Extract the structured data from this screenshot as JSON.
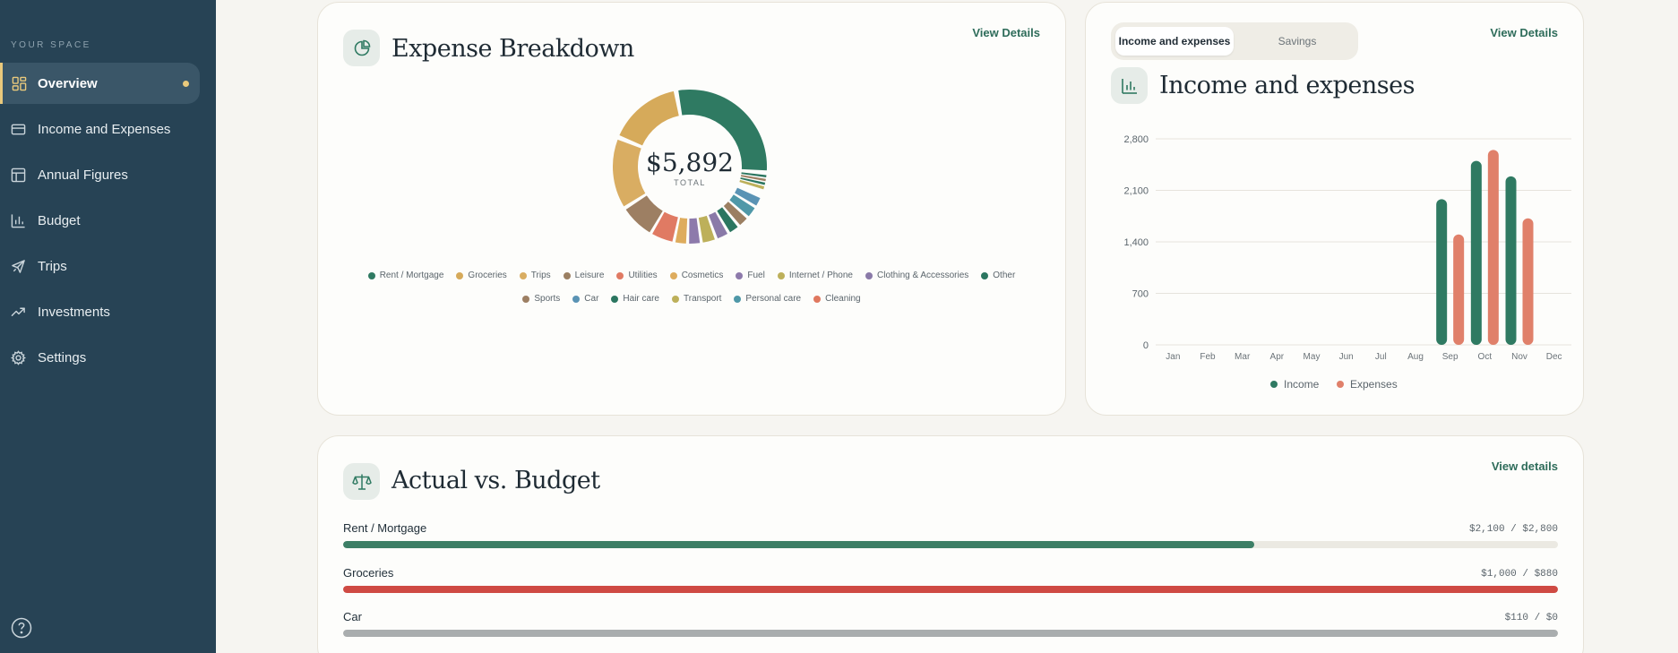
{
  "sidebar": {
    "section_label": "YOUR SPACE",
    "items": [
      {
        "label": "Overview",
        "icon": "dashboard-icon",
        "active": true
      },
      {
        "label": "Income and Expenses",
        "icon": "card-icon"
      },
      {
        "label": "Annual Figures",
        "icon": "table-icon"
      },
      {
        "label": "Budget",
        "icon": "bar-chart-icon"
      },
      {
        "label": "Trips",
        "icon": "plane-icon"
      },
      {
        "label": "Investments",
        "icon": "trending-up-icon"
      },
      {
        "label": "Settings",
        "icon": "gear-icon"
      }
    ],
    "help_icon": "help-circle-icon"
  },
  "expense_breakdown": {
    "title": "Expense Breakdown",
    "view_link": "View Details",
    "total_value": "$5,892",
    "total_label": "TOTAL",
    "categories": [
      {
        "name": "Rent / Mortgage",
        "color": "#2f7a62"
      },
      {
        "name": "Groceries",
        "color": "#d6aa5a"
      },
      {
        "name": "Trips",
        "color": "#d9ad62"
      },
      {
        "name": "Leisure",
        "color": "#9b7f62"
      },
      {
        "name": "Utilities",
        "color": "#e07a63"
      },
      {
        "name": "Cosmetics",
        "color": "#deac5d"
      },
      {
        "name": "Fuel",
        "color": "#8d7aab"
      },
      {
        "name": "Internet / Phone",
        "color": "#bdb05a"
      },
      {
        "name": "Clothing & Accessories",
        "color": "#8a7aa8"
      },
      {
        "name": "Other",
        "color": "#2b7660"
      },
      {
        "name": "Sports",
        "color": "#9d7f63"
      },
      {
        "name": "Car",
        "color": "#5a93b4"
      },
      {
        "name": "Hair care",
        "color": "#2b7660"
      },
      {
        "name": "Transport",
        "color": "#bdb05a"
      },
      {
        "name": "Personal care",
        "color": "#4f98a8"
      },
      {
        "name": "Cleaning",
        "color": "#e0785f"
      }
    ]
  },
  "income_expenses": {
    "tabs": [
      "Income and expenses",
      "Savings"
    ],
    "active_tab": 0,
    "title": "Income and expenses",
    "view_link": "View Details",
    "legend": [
      {
        "name": "Income",
        "color": "#2f7a62"
      },
      {
        "name": "Expenses",
        "color": "#e0806a"
      }
    ]
  },
  "chart_data": {
    "type": "bar",
    "categories": [
      "Jan",
      "Feb",
      "Mar",
      "Apr",
      "May",
      "Jun",
      "Jul",
      "Aug",
      "Sep",
      "Oct",
      "Nov",
      "Dec"
    ],
    "series": [
      {
        "name": "Income",
        "values": [
          0,
          0,
          0,
          0,
          0,
          0,
          0,
          0,
          1980,
          2500,
          2290,
          0
        ]
      },
      {
        "name": "Expenses",
        "values": [
          0,
          0,
          0,
          0,
          0,
          0,
          0,
          0,
          1500,
          2650,
          1720,
          0
        ]
      }
    ],
    "y_ticks": [
      "2,800",
      "2,100",
      "1,400",
      "700",
      "0"
    ],
    "ylim": [
      0,
      2800
    ],
    "grid": true,
    "legend_position": "bottom-center"
  },
  "budget": {
    "title": "Actual vs. Budget",
    "view_link": "View details",
    "rows": [
      {
        "name": "Rent / Mortgage",
        "amount": "$2,100 / $2,800",
        "fraction": 0.75,
        "color": "#3d7f66"
      },
      {
        "name": "Groceries",
        "amount": "$1,000 / $880",
        "fraction": 1.0,
        "color": "#cf4a43"
      },
      {
        "name": "Car",
        "amount": "$110 / $0",
        "fraction": 1.0,
        "color": "#a9adae"
      }
    ]
  }
}
